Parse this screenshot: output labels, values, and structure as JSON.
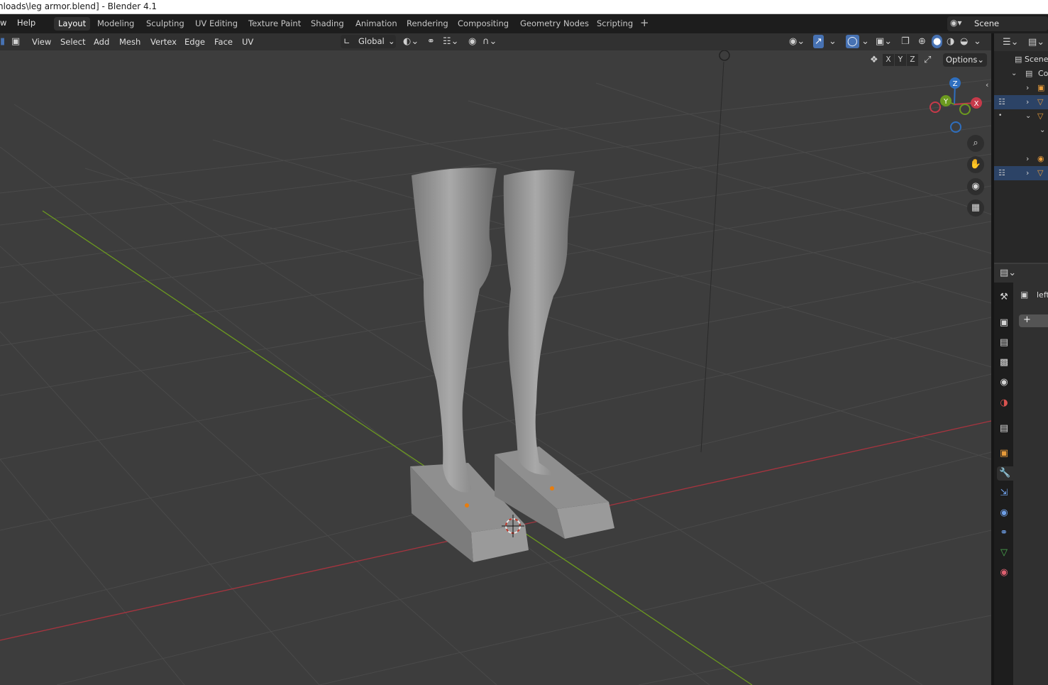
{
  "window": {
    "title": "nloads\\leg armor.blend] - Blender 4.1"
  },
  "top_menu": {
    "window_label": "w",
    "help_label": "Help"
  },
  "workspaces": [
    "Layout",
    "Modeling",
    "Sculpting",
    "UV Editing",
    "Texture Paint",
    "Shading",
    "Animation",
    "Rendering",
    "Compositing",
    "Geometry Nodes",
    "Scripting"
  ],
  "workspace_add": "+",
  "scene": {
    "name": "Scene"
  },
  "viewport_header": {
    "menus": [
      "View",
      "Select",
      "Add",
      "Mesh",
      "Vertex",
      "Edge",
      "Face",
      "UV"
    ],
    "transform_orientation": "Global"
  },
  "axis_toggles": [
    "X",
    "Y",
    "Z"
  ],
  "options_label": "Options",
  "gizmo": {
    "x": "X",
    "y": "Y",
    "z": "Z"
  },
  "outliner": {
    "scene_label": "Scene",
    "collection_label": "Co"
  },
  "properties": {
    "object_name_prefix": "left",
    "add_modifier": "+"
  },
  "colors": {
    "accent": "#4772b3",
    "x_axis": "#c73a4a",
    "y_axis": "#6c9a1f",
    "z_axis": "#2f6fbf",
    "origin_dot": "#e87d0d"
  },
  "icons": [
    "select-box-icon",
    "transform-pivot-icon",
    "snap-icon",
    "proportional-edit-icon",
    "visibility-icon",
    "gizmo-icon",
    "overlay-icon",
    "xray-icon",
    "shading-wireframe-icon",
    "shading-solid-icon",
    "shading-material-icon",
    "shading-rendered-icon",
    "zoom-icon",
    "pan-hand-icon",
    "camera-view-icon",
    "ortho-grid-icon",
    "tool-icon",
    "render-icon",
    "output-icon",
    "view-layer-icon",
    "scene-props-icon",
    "world-icon",
    "collection-icon",
    "object-icon",
    "modifier-wrench-icon",
    "particles-icon",
    "physics-icon",
    "constraints-icon",
    "data-icon",
    "material-icon"
  ]
}
